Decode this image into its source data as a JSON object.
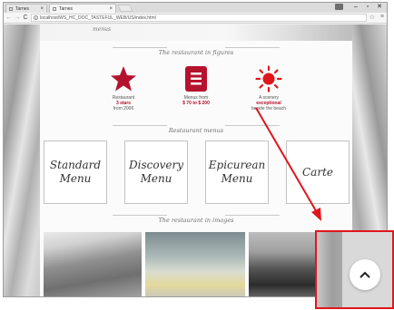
{
  "browser": {
    "tabs": [
      {
        "label": "Tarnes"
      },
      {
        "label": "Tarnes"
      }
    ],
    "window_controls": {
      "minimize": "–",
      "maximize": "▫",
      "close": "✕"
    },
    "url": "localhost/WS_HC_DOC_TASTEFUL_WEB/US/index.html"
  },
  "page": {
    "menus_label": "menus",
    "figures_title": "The restaurant in figures",
    "figures": [
      {
        "icon": "star-icon",
        "line1": "Restaurant",
        "highlight": "3 stars",
        "line3": "from 2006"
      },
      {
        "icon": "menu-document-icon",
        "line1": "Menus from",
        "highlight": "$ 70 to $ 200",
        "line3": ""
      },
      {
        "icon": "sun-icon",
        "line1": "A scenery",
        "highlight": "exceptional",
        "line3": "beside the beach"
      }
    ],
    "menus_title": "Restaurant menus",
    "menu_cards": [
      {
        "label": "Standard Menu"
      },
      {
        "label": "Discovery Menu"
      },
      {
        "label": "Epicurean Menu"
      },
      {
        "label": "Carte"
      }
    ],
    "images_title": "The restaurant in images"
  },
  "annotation": {
    "color": "#e0161c",
    "zoom_target": "scroll-to-top-button"
  },
  "colors": {
    "accent": "#b5122e",
    "sun": "#e0161c"
  }
}
